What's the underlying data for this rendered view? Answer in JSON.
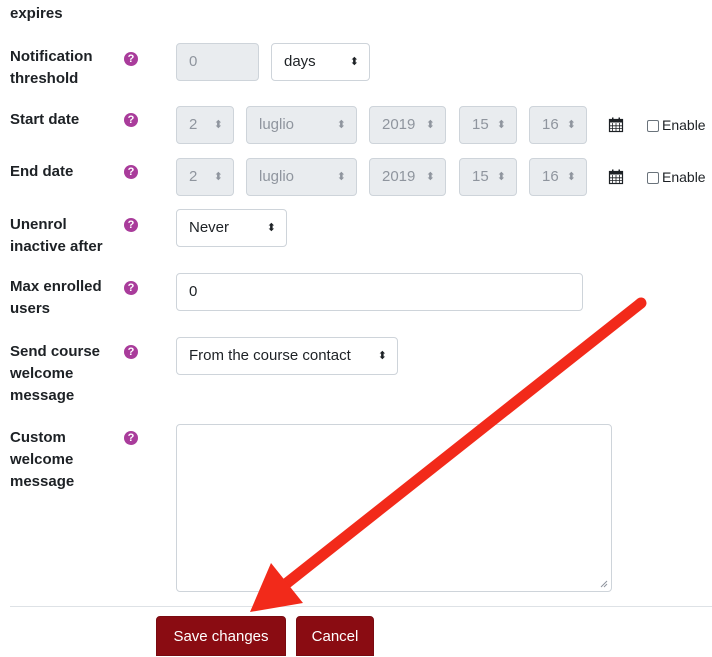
{
  "fields": {
    "expires_label": "expires",
    "notification": {
      "label_line1": "Notification",
      "label_line2": "threshold",
      "value": "0",
      "unit": "days"
    },
    "start_date": {
      "label": "Start date",
      "day": "2",
      "month": "luglio",
      "year": "2019",
      "hour": "15",
      "minute": "16",
      "enable_label": "Enable"
    },
    "end_date": {
      "label": "End date",
      "day": "2",
      "month": "luglio",
      "year": "2019",
      "hour": "15",
      "minute": "16",
      "enable_label": "Enable"
    },
    "unenrol": {
      "label_line1": "Unenrol",
      "label_line2": "inactive after",
      "value": "Never"
    },
    "max_enrolled": {
      "label_line1": "Max enrolled",
      "label_line2": "users",
      "value": "0"
    },
    "send_welcome": {
      "label_line1": "Send course",
      "label_line2": "welcome",
      "label_line3": "message",
      "value": "From the course contact"
    },
    "custom_welcome": {
      "label_line1": "Custom",
      "label_line2": "welcome",
      "label_line3": "message",
      "value": ""
    }
  },
  "buttons": {
    "save": "Save changes",
    "cancel": "Cancel"
  },
  "help_glyph": "?",
  "caret_glyph": "⬍",
  "icons": {
    "help": "question-circle-icon",
    "calendar": "calendar-icon",
    "caret": "updown-caret-icon",
    "annotation": "red-arrow-annotation"
  },
  "colors": {
    "help": "#a93c9b",
    "primary_button": "#8a0c12",
    "arrow": "#f22a1a",
    "disabled_bg": "#e9ecef"
  }
}
